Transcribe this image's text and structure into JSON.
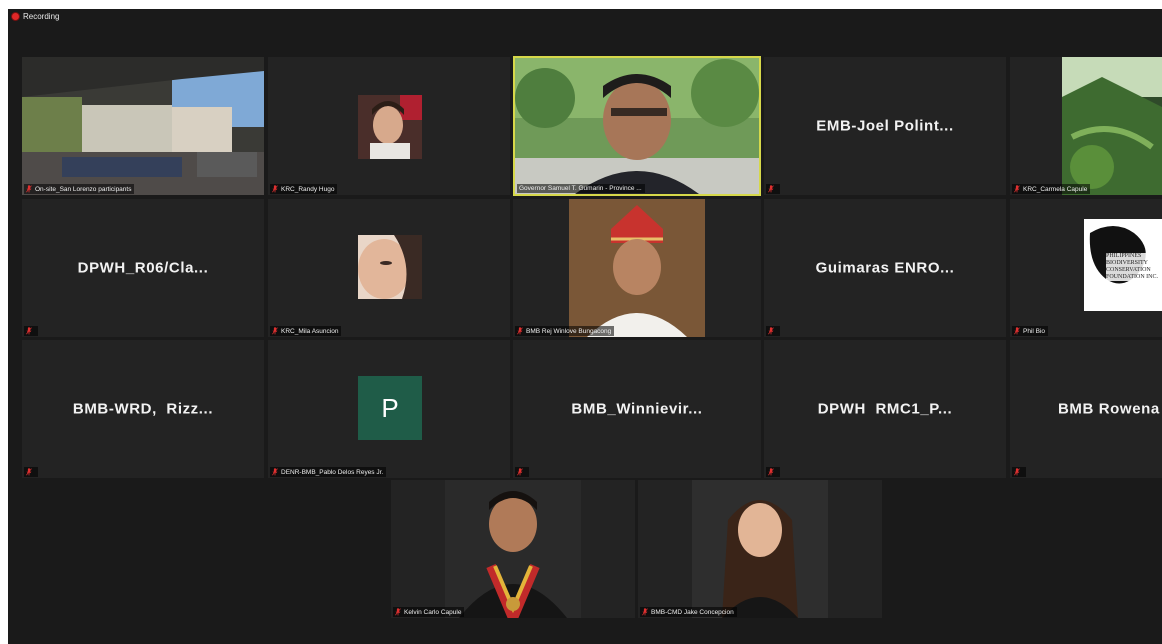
{
  "recording": {
    "label": "Recording"
  },
  "participants": [
    {
      "id": "p1",
      "display": "video",
      "label": "On-site_San Lorenzo participants"
    },
    {
      "id": "p2",
      "display": "photo",
      "label": "KRC_Randy Hugo"
    },
    {
      "id": "p3",
      "display": "video",
      "label": "Governor Samuel T. Gumarin - Province ...",
      "active_speaker": true
    },
    {
      "id": "p4",
      "display": "name",
      "big_name": "EMB-Joel Polint...",
      "label": ""
    },
    {
      "id": "p5",
      "display": "photo",
      "label": "KRC_Carmela Capule"
    },
    {
      "id": "p6",
      "display": "name",
      "big_name": "DPWH_R06/Cla...",
      "label": ""
    },
    {
      "id": "p7",
      "display": "photo",
      "label": "KRC_Mila Asuncion"
    },
    {
      "id": "p8",
      "display": "photo",
      "label": "BMB Rej Winlove Bungacong"
    },
    {
      "id": "p9",
      "display": "name",
      "big_name": "Guimaras ENRO...",
      "label": ""
    },
    {
      "id": "p10",
      "display": "logo",
      "label": "Phil Bio",
      "logo_text": "PHILIPPINES BIODIVERSITY CONSERVATION FOUNDATION INC."
    },
    {
      "id": "p11",
      "display": "name",
      "big_name": "BMB-WRD,  Rizz...",
      "label": ""
    },
    {
      "id": "p12",
      "display": "avatar",
      "avatar_letter": "P",
      "label": "DENR-BMB_Pablo Delos Reyes Jr."
    },
    {
      "id": "p13",
      "display": "name",
      "big_name": "BMB_Winnievir...",
      "label": ""
    },
    {
      "id": "p14",
      "display": "name",
      "big_name": "DPWH  RMC1_P...",
      "label": ""
    },
    {
      "id": "p15",
      "display": "name",
      "big_name": "BMB Rowena",
      "label": ""
    },
    {
      "id": "p16",
      "display": "photo",
      "label": "Kelvin Carlo Capule"
    },
    {
      "id": "p17",
      "display": "photo",
      "label": "BMB-CMD Jake Concepcion"
    }
  ],
  "colors": {
    "background": "#1a1a1a",
    "tile": "#232323",
    "active_border": "#d6d84a",
    "muted_icon": "#e03030",
    "avatar": "#1f5c48"
  }
}
